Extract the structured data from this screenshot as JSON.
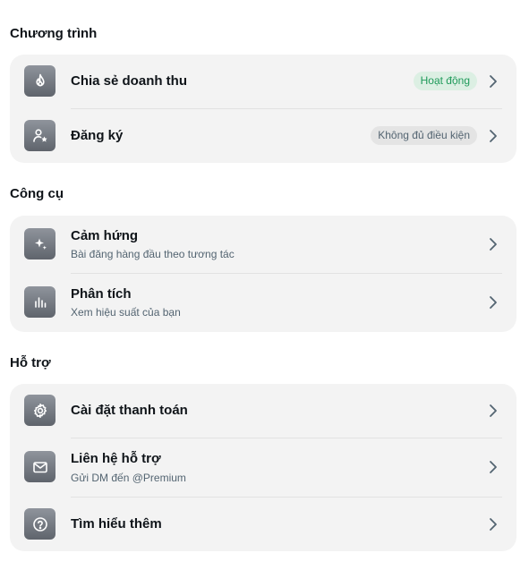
{
  "sections": [
    {
      "title": "Chương trình",
      "items": [
        {
          "label": "Chia sẻ doanh thu",
          "badge": "Hoạt động"
        },
        {
          "label": "Đăng ký",
          "badge": "Không đủ điều kiện"
        }
      ]
    },
    {
      "title": "Công cụ",
      "items": [
        {
          "label": "Cảm hứng",
          "sub": "Bài đăng hàng đầu theo tương tác"
        },
        {
          "label": "Phân tích",
          "sub": "Xem hiệu suất của bạn"
        }
      ]
    },
    {
      "title": "Hỗ trợ",
      "items": [
        {
          "label": "Cài đặt thanh toán"
        },
        {
          "label": "Liên hệ hỗ trợ",
          "sub": "Gửi DM đến @Premium"
        },
        {
          "label": "Tìm hiểu thêm"
        }
      ]
    }
  ],
  "colors": {
    "active_badge_bg": "#dcefe3",
    "active_badge_text": "#1f9a5a",
    "ineligible_badge_bg": "#e4e4e4"
  },
  "icons": [
    "flame-icon",
    "person-star-icon",
    "sparkle-icon",
    "bar-chart-icon",
    "gear-icon",
    "mail-icon",
    "help-circle-icon",
    "chevron-right-icon"
  ]
}
